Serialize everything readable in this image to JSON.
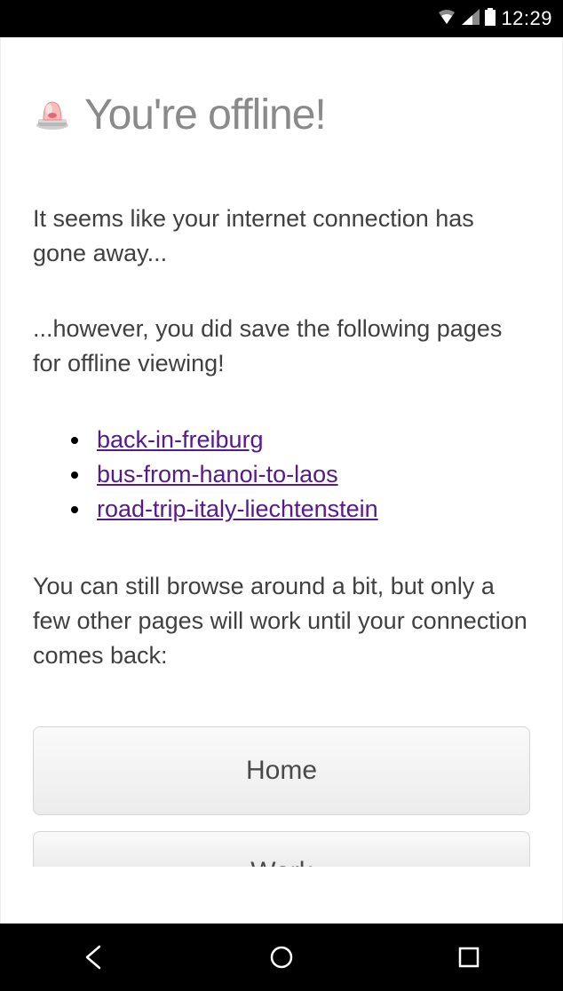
{
  "status": {
    "time": "12:29"
  },
  "page": {
    "title": "You're offline!",
    "para1": "It seems like your internet connection has gone away...",
    "para2": "...however, you did save the following pages for offline viewing!",
    "links": [
      {
        "label": "back-in-freiburg"
      },
      {
        "label": "bus-from-hanoi-to-laos"
      },
      {
        "label": "road-trip-italy-liechtenstein"
      }
    ],
    "para3": "You can still browse around a bit, but only a few other pages will work until your connection comes back:",
    "buttons": [
      {
        "label": "Home"
      },
      {
        "label": "Work"
      }
    ]
  }
}
